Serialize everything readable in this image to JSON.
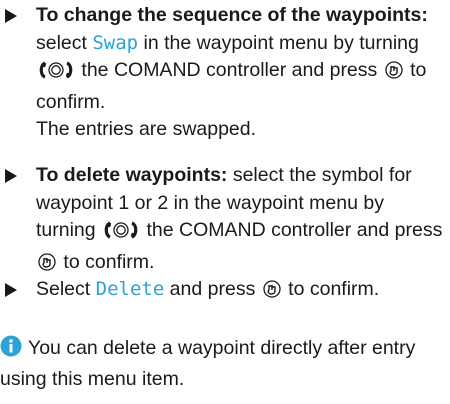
{
  "section1": {
    "heading": "To change the sequence of the waypoints:",
    "text_a": " select ",
    "option": "Swap",
    "text_b": " in the waypoint menu by turning ",
    "text_c": " the COMAND controller and press ",
    "text_d": " to confirm.",
    "result": "The entries are swapped."
  },
  "section2": {
    "heading": "To delete waypoints:",
    "text_a": " select the symbol for waypoint 1 or 2 in the waypoint menu by turning ",
    "text_b": " the COMAND controller and press ",
    "text_c": " to confirm."
  },
  "section3": {
    "text_a": "Select ",
    "option": "Delete",
    "text_b": " and press ",
    "text_c": " to confirm."
  },
  "note": {
    "text": "You can delete a waypoint directly after entry using this menu item."
  },
  "colors": {
    "option_text": "#2aa3d6",
    "info_icon": "#2aa3d6"
  },
  "icons": {
    "bullet": "triangle-bullet-icon",
    "turn": "turn-controller-icon",
    "press": "press-controller-icon",
    "info": "info-icon"
  }
}
